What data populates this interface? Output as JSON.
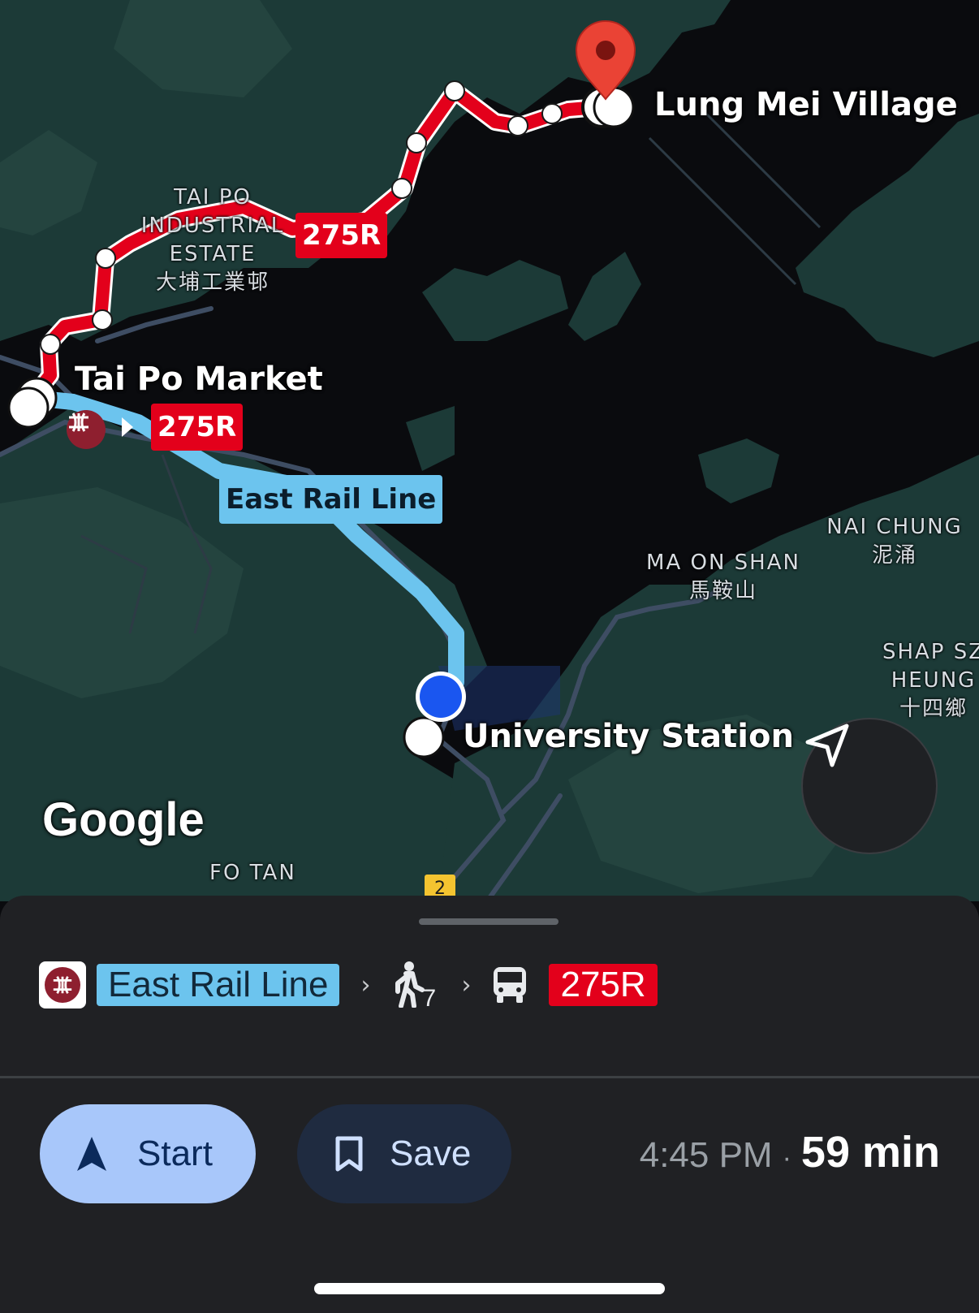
{
  "map": {
    "destination": "Lung Mei Village",
    "transfer_stop": "Tai Po Market",
    "origin_station": "University Station",
    "area_labels": {
      "tai_po_ie": [
        "TAI PO",
        "INDUSTRIAL",
        "ESTATE",
        "大埔工業邨"
      ],
      "ma_on_shan": [
        "MA ON SHAN",
        "馬鞍山"
      ],
      "nai_chung": [
        "NAI CHUNG",
        "泥涌"
      ],
      "shap_sz_heung": [
        "SHAP SZ",
        "HEUNG",
        "十四鄉"
      ],
      "fo_tan": "FO TAN"
    },
    "route_badges": {
      "bus_route": "275R",
      "rail_line": "East Rail Line",
      "road_shield": "2"
    },
    "logo": "Google",
    "colors": {
      "bus_route": "#e3001b",
      "rail_route": "#6cc4ee",
      "current_location": "#1a56f0",
      "destination_pin": "#ea4335",
      "water": "#0a0b0e",
      "land": "#1c3a37"
    },
    "recenter_icon": "navigation-arrow-icon"
  },
  "sheet": {
    "steps": [
      {
        "type": "rail",
        "icon": "mtr-logo-icon",
        "label": "East Rail Line"
      },
      {
        "type": "walk",
        "icon": "walk-icon",
        "minutes": "7"
      },
      {
        "type": "bus",
        "icon": "bus-icon",
        "label": "275R"
      }
    ],
    "start_button": "Start",
    "save_button": "Save",
    "departure_time": "4:45 PM",
    "separator": "·",
    "duration": "59 min"
  }
}
